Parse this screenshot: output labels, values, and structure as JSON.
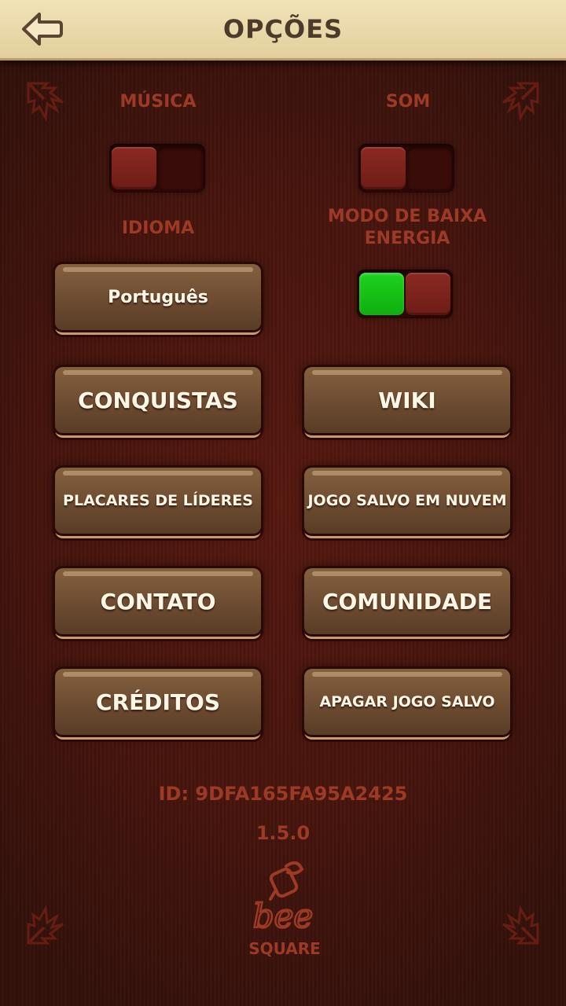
{
  "header": {
    "title": "OPÇÕES",
    "back_icon": "back-arrow-icon"
  },
  "settings": {
    "music": {
      "label": "MÚSICA",
      "enabled": false
    },
    "sound": {
      "label": "SOM",
      "enabled": false
    },
    "language": {
      "label": "IDIOMA",
      "value": "Português"
    },
    "low_power": {
      "label_line1": "MODO DE BAIXA",
      "label_line2": "ENERGIA",
      "enabled": true
    }
  },
  "buttons": {
    "achievements": "CONQUISTAS",
    "wiki": "WIKI",
    "leaderboards": "PLACARES DE LÍDERES",
    "cloud_save": "JOGO SALVO EM NUVEM",
    "contact": "CONTATO",
    "community": "COMUNIDADE",
    "credits": "CRÉDITOS",
    "delete_save": "APAGAR JOGO SALVO"
  },
  "footer": {
    "player_id": "ID: 9DFA165FA95A2425",
    "version": "1.5.0",
    "logo_line1": "bee",
    "logo_line2": "SQUARE",
    "logo_icon": "bee-square-logo-icon"
  },
  "colors": {
    "accent_text": "#9c3a26",
    "toggle_on": "#1fd21f",
    "button_face": "#6a4a30",
    "header_bg": "#eddcb0"
  }
}
